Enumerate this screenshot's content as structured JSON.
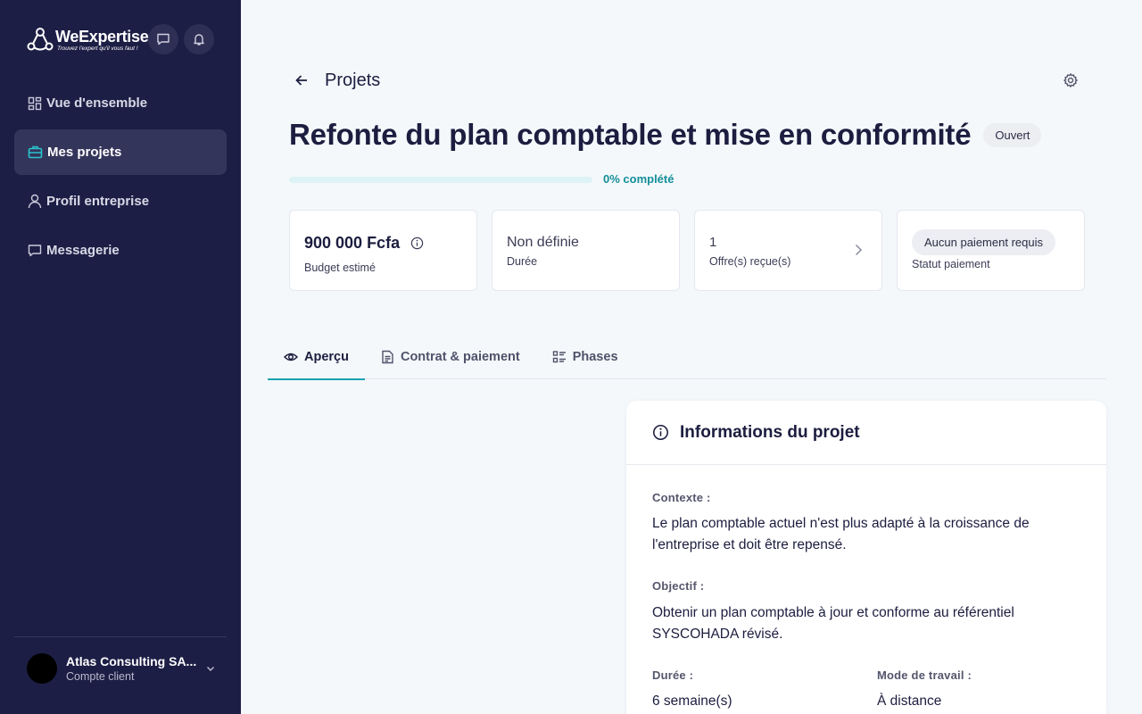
{
  "brand": {
    "name": "WeExpertise",
    "tagline": "Trouvez l'expert qu'il vous faut !"
  },
  "sidebar": {
    "items": [
      {
        "label": "Vue d'ensemble",
        "icon": "dashboard-icon",
        "active": false
      },
      {
        "label": "Mes projets",
        "icon": "briefcase-icon",
        "active": true
      },
      {
        "label": "Profil entreprise",
        "icon": "user-icon",
        "active": false
      },
      {
        "label": "Messagerie",
        "icon": "message-icon",
        "active": false
      }
    ],
    "account": {
      "name": "Atlas Consulting SA...",
      "role": "Compte client"
    }
  },
  "header": {
    "title": "Projets"
  },
  "project": {
    "title": "Refonte du plan comptable et mise en conformité",
    "status": "Ouvert",
    "progress_percent": 0,
    "progress_label": "0% complété"
  },
  "stats": {
    "budget": {
      "value": "900 000 Fcfa",
      "label": "Budget estimé"
    },
    "duration": {
      "value": "Non définie",
      "label": "Durée"
    },
    "offers": {
      "value": "1",
      "label": "Offre(s) reçue(s)"
    },
    "payment": {
      "value": "Aucun paiement requis",
      "label": "Statut paiement"
    }
  },
  "tabs": [
    {
      "label": "Aperçu",
      "icon": "eye-icon",
      "active": true
    },
    {
      "label": "Contrat & paiement",
      "icon": "document-icon",
      "active": false
    },
    {
      "label": "Phases",
      "icon": "checklist-icon",
      "active": false
    }
  ],
  "info": {
    "title": "Informations du projet",
    "context_label": "Contexte :",
    "context_line1": "Le plan comptable actuel n'est plus adapté à la croissance de",
    "context_line2": "l'entreprise et doit être repensé.",
    "objective_label": "Objectif :",
    "objective_line1": "Obtenir un plan comptable à jour et conforme au référentiel",
    "objective_line2": "SYSCOHADA révisé.",
    "duration_label": "Durée :",
    "duration_value": "6 semaine(s)",
    "mode_label": "Mode de travail :",
    "mode_value": "À distance"
  },
  "colors": {
    "sidebar": "#1d1e45",
    "accent": "#16a3b0",
    "text": "#1c1d3f"
  }
}
